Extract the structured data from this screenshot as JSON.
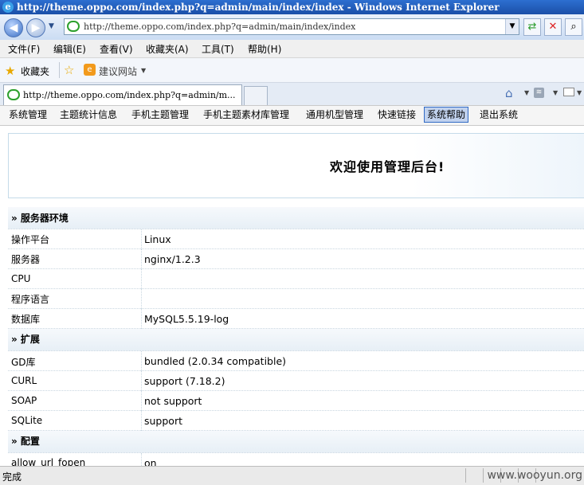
{
  "window": {
    "title": "http://theme.oppo.com/index.php?q=admin/main/index/index - Windows Internet Explorer",
    "address": "http://theme.oppo.com/index.php?q=admin/main/index/index"
  },
  "menu": [
    "文件(F)",
    "编辑(E)",
    "查看(V)",
    "收藏夹(A)",
    "工具(T)",
    "帮助(H)"
  ],
  "favorites": {
    "label": "收藏夹",
    "suggested": "建议网站"
  },
  "tab": {
    "title": "http://theme.oppo.com/index.php?q=admin/m..."
  },
  "appnav": [
    "系统管理",
    "主题统计信息",
    "手机主题管理",
    "手机主题素材库管理",
    "通用机型管理",
    "快速链接",
    "系统帮助",
    "退出系统"
  ],
  "appnav_active": "系统帮助",
  "welcome": "欢迎使用管理后台!",
  "sections": [
    {
      "title": "» 服务器环境",
      "rows": [
        [
          "操作平台",
          "Linux"
        ],
        [
          "服务器",
          "nginx/1.2.3"
        ],
        [
          "CPU",
          ""
        ],
        [
          "程序语言",
          ""
        ],
        [
          "数据库",
          "MySQL5.5.19-log"
        ]
      ]
    },
    {
      "title": "» 扩展",
      "rows": [
        [
          "GD库",
          "bundled (2.0.34 compatible)"
        ],
        [
          "CURL",
          "support (7.18.2)"
        ],
        [
          "SOAP",
          "not support"
        ],
        [
          "SQLite",
          "support"
        ]
      ]
    },
    {
      "title": "» 配置",
      "rows": [
        [
          "allow_url_fopen",
          "on"
        ]
      ]
    }
  ],
  "status": {
    "text": "完成",
    "watermark": "www.wooyun.org"
  }
}
